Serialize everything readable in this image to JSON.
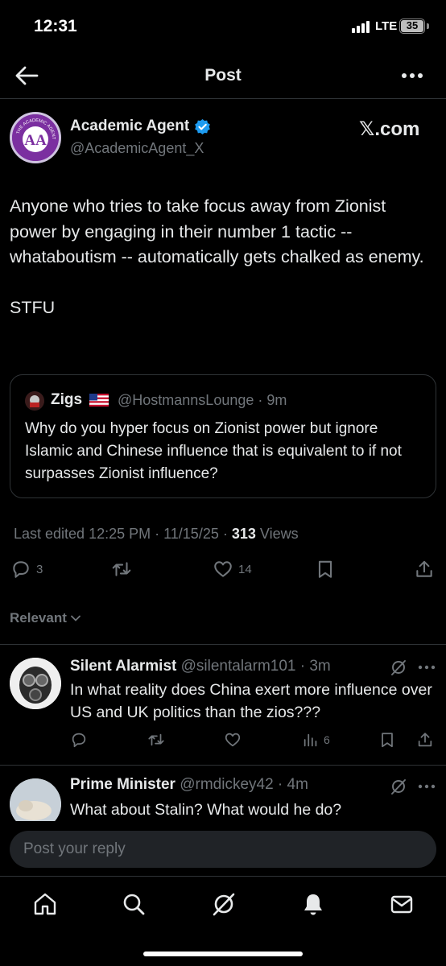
{
  "status_bar": {
    "time": "12:31",
    "network": "LTE",
    "battery": "35"
  },
  "header": {
    "title": "Post"
  },
  "post": {
    "author_name": "Academic Agent",
    "author_handle": "@AcademicAgent_X",
    "brand": "𝕏.com",
    "avatar_text": "THE ACADEMIC AGENT",
    "text": "Anyone who tries to take focus away from Zionist power by engaging in their number 1 tactic -- whataboutism -- automatically gets chalked as enemy.\n\nSTFU",
    "quote": {
      "name": "Zigs",
      "handle": "@HostmannsLounge · 9m",
      "text": "Why do you hyper focus on Zionist power but ignore Islamic and Chinese influence that is equivalent to if not surpasses Zionist influence?"
    },
    "meta": {
      "edited": "Last edited 12:25 PM · 11/15/25 · ",
      "views_count": "313",
      "views_label": " Views"
    },
    "actions": {
      "replies": "3",
      "reposts": "",
      "likes": "14"
    }
  },
  "sort": {
    "label": "Relevant"
  },
  "replies": [
    {
      "name": "Silent Alarmist",
      "handle": "@silentalarm101 · 3m",
      "text": "In what reality does China exert more influence over US and UK politics than the zios???",
      "views": "6"
    },
    {
      "name": "Prime Minister",
      "handle": "@rmdickey42 · 4m",
      "text": "What about Stalin? What would he do?"
    }
  ],
  "composer": {
    "placeholder": "Post your reply"
  },
  "colors": {
    "background": "#000000",
    "text": "#e7e9ea",
    "muted": "#71767b",
    "verified": "#1d9bf0",
    "border": "#2f3336"
  },
  "icons": [
    "back-arrow-icon",
    "more-icon",
    "verified-icon",
    "reply-icon",
    "repost-icon",
    "like-icon",
    "bookmark-icon",
    "share-icon",
    "views-icon",
    "grok-icon",
    "home-icon",
    "search-icon",
    "notifications-icon",
    "messages-icon"
  ]
}
